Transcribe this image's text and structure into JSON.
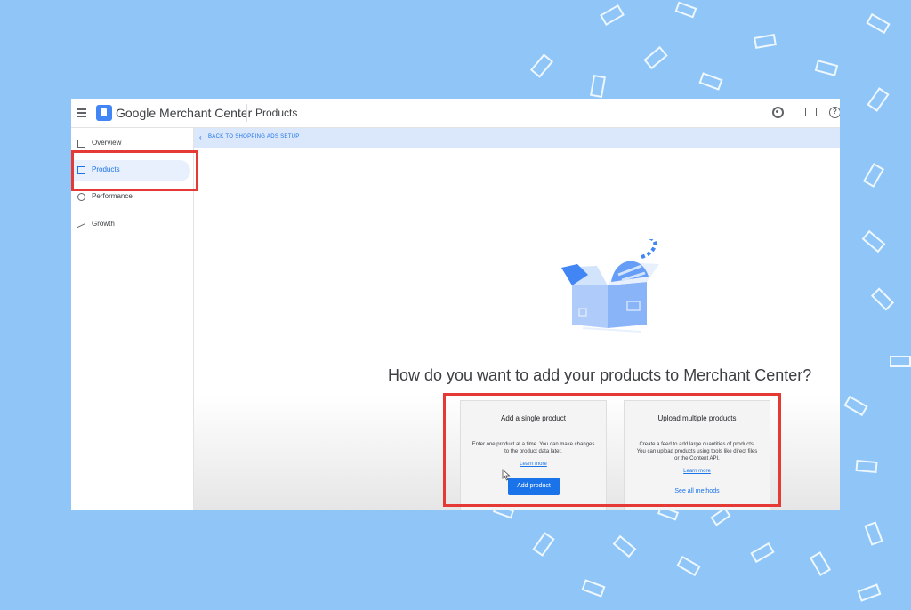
{
  "topbar": {
    "brand": "Google Merchant Center",
    "page_title": "Products",
    "help_glyph": "?"
  },
  "sidebar": {
    "items": [
      {
        "label": "Overview",
        "icon": "dashboard-icon"
      },
      {
        "label": "Products",
        "icon": "products-icon",
        "active": true
      },
      {
        "label": "Performance",
        "icon": "performance-icon"
      },
      {
        "label": "Growth",
        "icon": "growth-icon"
      }
    ]
  },
  "main": {
    "back_link": "BACK TO SHOPPING ADS SETUP",
    "back_chevron": "‹",
    "heading": "How do you want to add your products to Merchant Center?",
    "cards": [
      {
        "title": "Add a single product",
        "description": "Enter one product at a time. You can make changes to the product data later.",
        "link": "Learn more",
        "button": "Add product"
      },
      {
        "title": "Upload multiple products",
        "description": "Create a feed to add large quantities of products. You can upload products using tools like direct files or the Content API.",
        "link": "Learn more",
        "action_link": "See all methods"
      }
    ]
  },
  "colors": {
    "background": "#8fc6f7",
    "accent": "#1a73e8",
    "highlight": "#e53935"
  }
}
